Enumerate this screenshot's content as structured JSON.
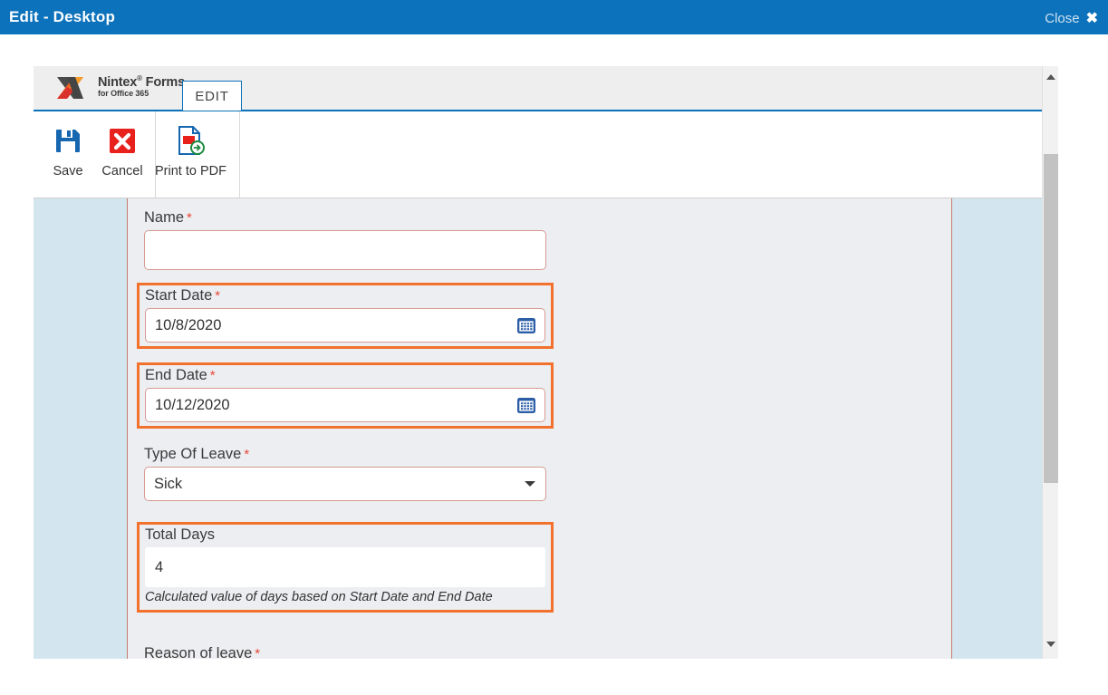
{
  "titlebar": {
    "title": "Edit - Desktop",
    "close_label": "Close",
    "close_glyph": "✖",
    "bg_color": "#0c72bb"
  },
  "branding": {
    "product": "Nintex",
    "product_sup": "®",
    "product_2": "Forms",
    "tagline": "for Office 365"
  },
  "tabs": [
    {
      "label": "EDIT",
      "active": true
    }
  ],
  "toolbar": {
    "buttons": [
      {
        "label": "Save",
        "icon": "save-floppy-icon"
      },
      {
        "label": "Cancel",
        "icon": "cancel-x-icon"
      },
      {
        "label": "Print to PDF",
        "icon": "print-to-pdf-icon"
      }
    ]
  },
  "form": {
    "fields": [
      {
        "id": "name",
        "label": "Name",
        "required": true,
        "required_marker": "*",
        "value": "",
        "type": "text",
        "highlighted": false
      },
      {
        "id": "start_date",
        "label": "Start Date",
        "required": true,
        "required_marker": "*",
        "value": "10/8/2020",
        "type": "date",
        "icon": "calendar-icon",
        "highlighted": true
      },
      {
        "id": "end_date",
        "label": "End Date",
        "required": true,
        "required_marker": "*",
        "value": "10/12/2020",
        "type": "date",
        "icon": "calendar-icon",
        "highlighted": true
      },
      {
        "id": "type_of_leave",
        "label": "Type Of Leave",
        "required": true,
        "required_marker": "*",
        "value": "Sick",
        "type": "select",
        "icon": "chevron-down-icon",
        "highlighted": false
      },
      {
        "id": "total_days",
        "label": "Total Days",
        "required": false,
        "required_marker": "",
        "value": "4",
        "type": "calculated",
        "helper": "Calculated value of days based on Start Date and End Date",
        "highlighted": true
      },
      {
        "id": "reason_of_leave",
        "label": "Reason of leave",
        "required": true,
        "required_marker": "*",
        "value": "",
        "type": "text",
        "highlighted": false,
        "clipped": true
      }
    ]
  },
  "scrollbar": {
    "up_arrow": "scroll-up-arrow",
    "down_arrow": "scroll-down-arrow"
  },
  "colors": {
    "highlight": "#f2712c",
    "required": "#e8493a",
    "accent": "#0c72bb",
    "panel": "#eceef1",
    "side": "#d3e6ef"
  }
}
